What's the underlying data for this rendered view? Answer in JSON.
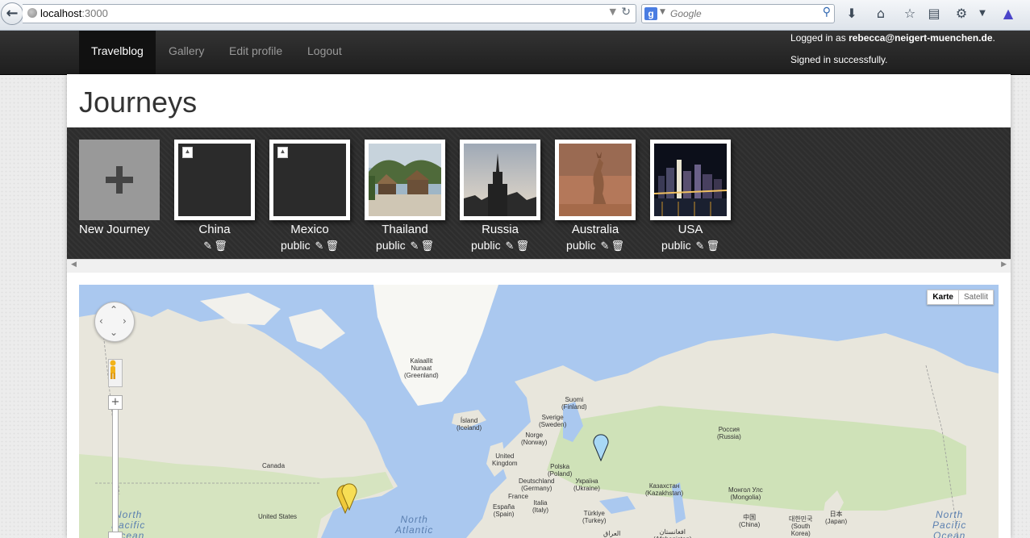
{
  "browser": {
    "url_host": "localhost",
    "url_port": ":3000",
    "search_placeholder": "Google",
    "search_engine_letter": "g"
  },
  "navbar": {
    "brand": "Travelblog",
    "items": [
      "Gallery",
      "Edit profile",
      "Logout"
    ],
    "logged_in_prefix": "Logged in as ",
    "user_email": "rebecca@neigert-muenchen.de",
    "logged_in_suffix": ".",
    "flash": "Signed in successfully."
  },
  "page": {
    "title": "Journeys"
  },
  "new_journey": {
    "label": "New Journey"
  },
  "journeys": [
    {
      "title": "China",
      "visibility": "",
      "image": "broken"
    },
    {
      "title": "Mexico",
      "visibility": "public",
      "image": "broken"
    },
    {
      "title": "Thailand",
      "visibility": "public",
      "image": "photo-huts"
    },
    {
      "title": "Russia",
      "visibility": "public",
      "image": "photo-tower"
    },
    {
      "title": "Australia",
      "visibility": "public",
      "image": "photo-kangaroo"
    },
    {
      "title": "USA",
      "visibility": "public",
      "image": "photo-skyline"
    }
  ],
  "icons": {
    "edit": "pencil-icon",
    "delete": "trash-icon"
  },
  "map": {
    "map_types": [
      "Karte",
      "Satellit"
    ],
    "active_type": "Karte",
    "labels": [
      "Kalaallit\nNunaat\n(Greenland)",
      "Suomi\n(Finland)",
      "Sverige\n(Sweden)",
      "Ísland\n(Iceland)",
      "Norge\n(Norway)",
      "United\nKingdom",
      "Polska\n(Poland)",
      "Deutschland\n(Germany)",
      "Україна\n(Ukraine)",
      "France",
      "Italia\n(Italy)",
      "España\n(Spain)",
      "Türkiye\n(Turkey)",
      "Россия\n(Russia)",
      "Казахстан\n(Kazakhstan)",
      "Монгол Улс\n(Mongolia)",
      "中国\n(China)",
      "대한민국\n(South\nKorea)",
      "日本\n(Japan)",
      "Canada",
      "United States",
      "العراق",
      "افغانستان\n(Afghanistan)"
    ],
    "oceans": [
      "North\nPacific\nOcean",
      "North\nAtlantic",
      "North\nPacific\nOcean"
    ],
    "colors": {
      "water": "#aac8ef",
      "land": "#e8e6dc",
      "ice": "#f7f7f3",
      "green": "#cfe2b8",
      "marker_yellow": "#f5d53a",
      "marker_blue": "#9fd3f5"
    }
  }
}
